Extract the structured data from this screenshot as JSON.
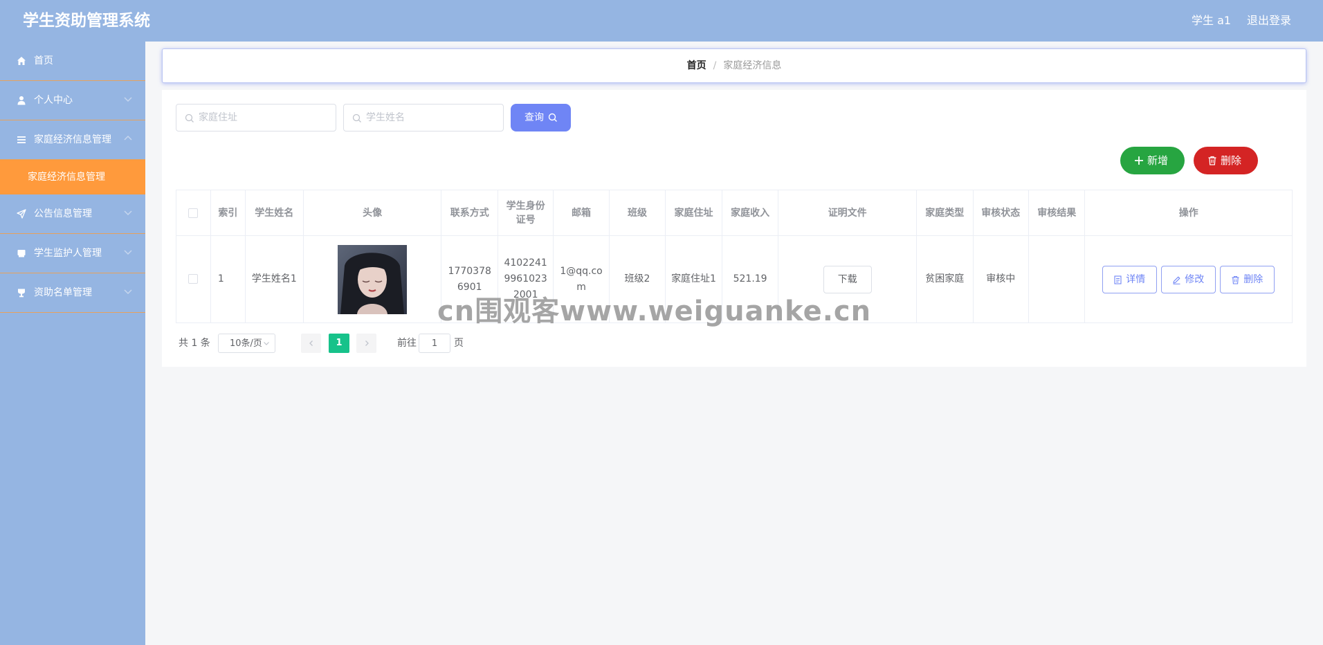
{
  "app": {
    "title": "学生资助管理系统"
  },
  "topbar": {
    "user": "学生 a1",
    "logout": "退出登录"
  },
  "sidebar": {
    "items": [
      {
        "label": "首页",
        "icon": "home-icon"
      },
      {
        "label": "个人中心",
        "icon": "user-icon"
      },
      {
        "label": "家庭经济信息管理",
        "icon": "menu-icon"
      },
      {
        "label": "家庭经济信息管理",
        "icon": ""
      },
      {
        "label": "公告信息管理",
        "icon": "send-icon"
      },
      {
        "label": "学生监护人管理",
        "icon": "box-icon"
      },
      {
        "label": "资助名单管理",
        "icon": "cup-icon"
      }
    ]
  },
  "breadcrumb": {
    "home": "首页",
    "separator": "/",
    "current": "家庭经济信息"
  },
  "search": {
    "address_placeholder": "家庭住址",
    "name_placeholder": "学生姓名",
    "query_label": "查询"
  },
  "actions": {
    "add_label": "新增",
    "delete_label": "删除"
  },
  "table": {
    "columns": [
      "索引",
      "学生姓名",
      "头像",
      "联系方式",
      "学生身份证号",
      "邮箱",
      "班级",
      "家庭住址",
      "家庭收入",
      "证明文件",
      "家庭类型",
      "审核状态",
      "审核结果",
      "操作"
    ],
    "rows": [
      {
        "index": "1",
        "name": "学生姓名1",
        "phone": "17703786901",
        "id_card": "410224199610232001",
        "email": "1@qq.com",
        "class": "班级2",
        "address": "家庭住址1",
        "income": "521.19",
        "proof": "下载",
        "family_type": "贫困家庭",
        "status": "审核中",
        "result": ""
      }
    ],
    "row_actions": {
      "detail": "详情",
      "edit": "修改",
      "delete": "删除"
    }
  },
  "pagination": {
    "total": "共 1 条",
    "page_size": "10条/页",
    "current_page": "1",
    "goto_label": "前往",
    "goto_value": "1",
    "page_suffix": "页"
  },
  "watermark": "cn围观客www.weiguanke.cn",
  "colors": {
    "header_bg": "#95b5e2",
    "sidebar_bg": "#95b5e2",
    "active_menu": "#ff9a3c",
    "primary": "#6f85f5",
    "add_button": "#27a541",
    "delete_button": "#d42424",
    "current_page": "#17c28a"
  }
}
